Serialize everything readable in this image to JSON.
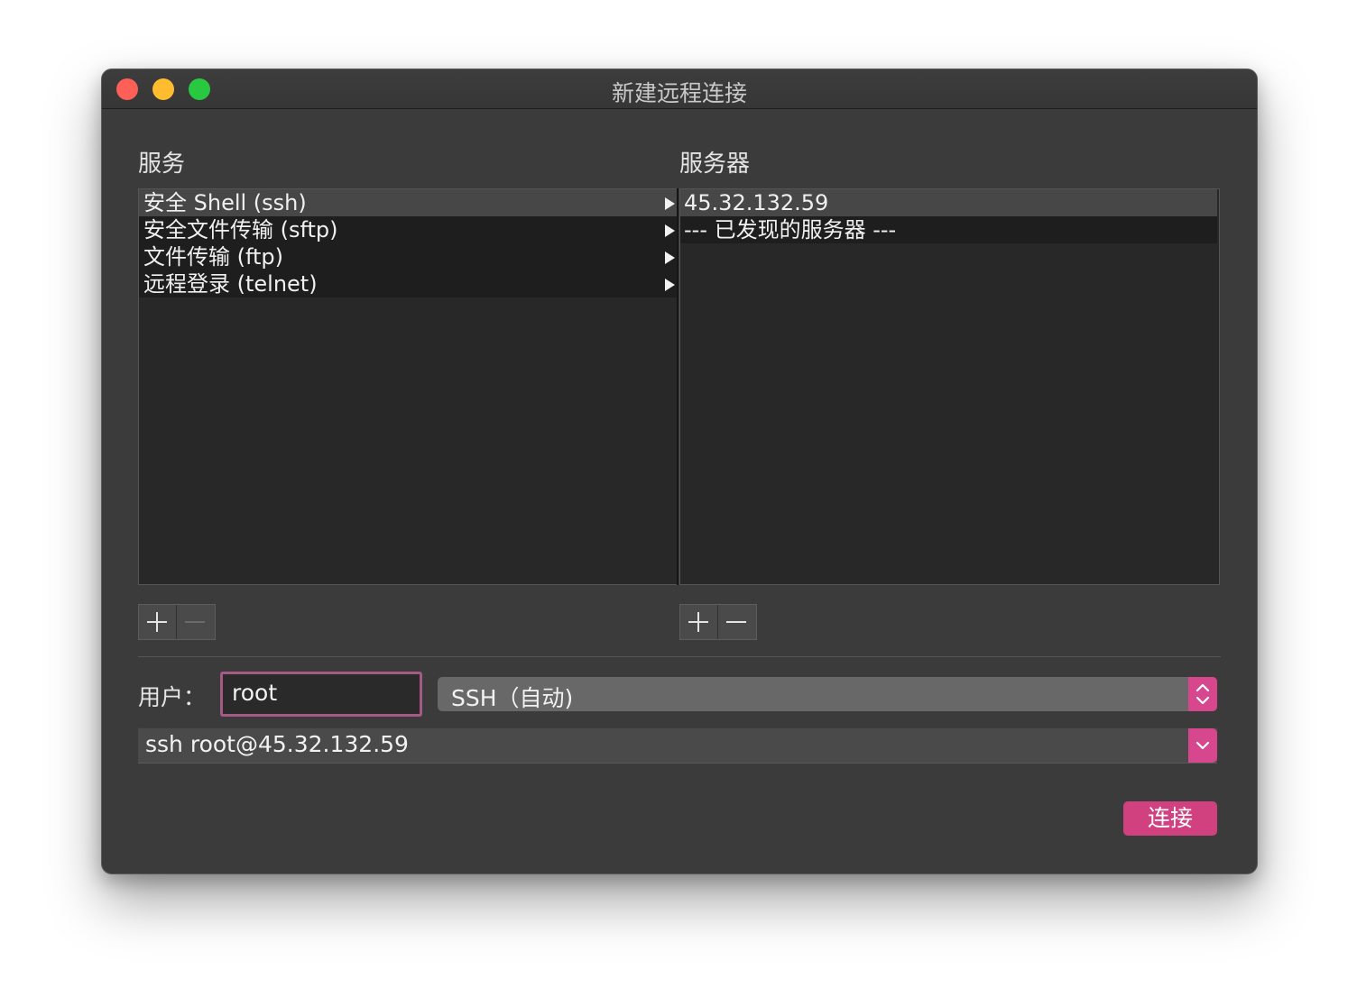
{
  "window": {
    "title": "新建远程连接"
  },
  "services": {
    "label": "服务",
    "items": [
      {
        "label": "安全 Shell (ssh)"
      },
      {
        "label": "安全文件传输 (sftp)"
      },
      {
        "label": "文件传输 (ftp)"
      },
      {
        "label": "远程登录 (telnet)"
      }
    ]
  },
  "servers": {
    "label": "服务器",
    "items": [
      {
        "label": "45.32.132.59"
      },
      {
        "label": "--- 已发现的服务器 ---"
      }
    ]
  },
  "user": {
    "label": "用户：",
    "value": "root"
  },
  "protocol": {
    "selected": "SSH（自动)"
  },
  "command": {
    "value": "ssh root@45.32.132.59"
  },
  "buttons": {
    "connect": "连接"
  },
  "colors": {
    "accent": "#d6478d",
    "focus_ring": "#a55a85"
  }
}
